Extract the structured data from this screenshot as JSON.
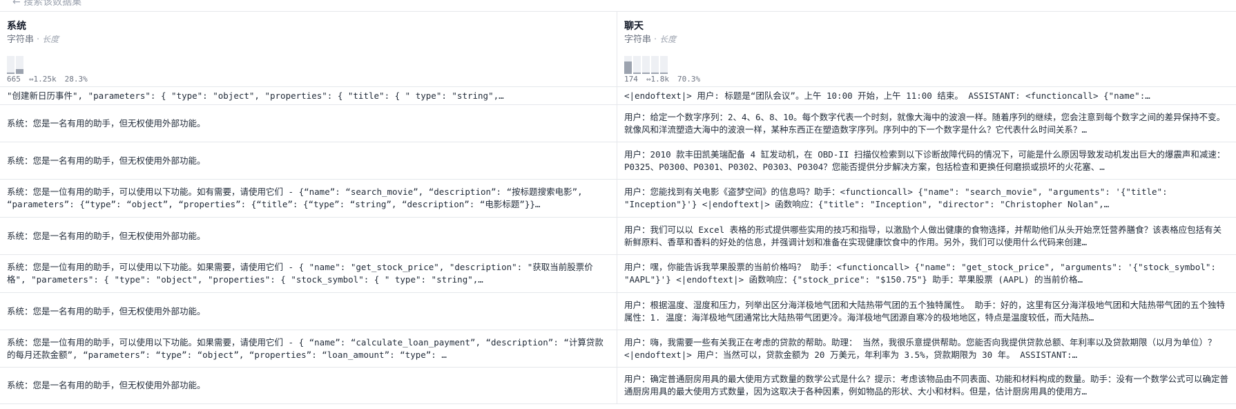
{
  "topbar": {
    "crumb": "← 搜索该数据集"
  },
  "columns": [
    {
      "title": "系统",
      "type_label": "字符串",
      "type_detail": "长度",
      "stats": [
        "665",
        "⇔1.25k",
        "28.3%"
      ],
      "hist": {
        "bins": [
          0.05,
          0.28
        ]
      }
    },
    {
      "title": "聊天",
      "type_label": "字符串",
      "type_detail": "长度",
      "stats": [
        "174",
        "⇔1.8k",
        "70.3%"
      ],
      "hist": {
        "bins": [
          0.7,
          0.08,
          0.08,
          0.05,
          0.04
        ]
      }
    }
  ],
  "rows": [
    {
      "system": "\"创建新日历事件\", \"parameters\": { \"type\": \"object\", \"properties\": { \"title\": { \" type\": \"string\",…",
      "chat": "<|endoftext|> 用户: 标题是“团队会议”。上午 10:00 开始，上午 11:00 结束。 ASSISTANT: <functioncall> {\"name\":…"
    },
    {
      "system": "系统：您是一名有用的助手，但无权使用外部功能。",
      "chat": "用户：给定一个数字序列：2、4、6、8、10。每个数字代表一个时刻，就像大海中的波浪一样。随着序列的继续，您会注意到每个数字之间的差异保持不变。就像风和洋流塑造大海中的波浪一样，某种东西正在塑造数字序列。序列中的下一个数字是什么？它代表什么时间关系？…"
    },
    {
      "system": "系统：您是一名有用的助手，但无权使用外部功能。",
      "chat": "用户：2010 款丰田凯美瑞配备 4 缸发动机，在 OBD-II 扫描仪检索到以下诊断故障代码的情况下，可能是什么原因导致发动机发出巨大的爆震声和减速：P0325、P0300、P0301、P0302、P0303、P0304？您能否提供分步解决方案，包括检查和更换任何磨损或损坏的火花塞、…"
    },
    {
      "system": "系统：您是一位有用的助手，可以使用以下功能。如有需要，请使用它们 - {“name”: “search_movie”, “description”: “按标题搜索电影”, “parameters”: {“type”: “object”, “properties”: {“title”: {“type”: “string”, “description”: “电影标题”}}…",
      "chat": "用户：您能找到有关电影《盗梦空间》的信息吗？助手：<functioncall> {\"name\": \"search_movie\", \"arguments\": '{\"title\": \"Inception\"}'} <|endoftext|> 函数响应：{\"title\": \"Inception\", \"director\": \"Christopher Nolan\",…"
    },
    {
      "system": "系统：您是一名有用的助手，但无权使用外部功能。",
      "chat": "用户：我们可以以 Excel 表格的形式提供哪些实用的技巧和指导，以激励个人做出健康的食物选择，并帮助他们从头开始烹饪营养膳食？该表格应包括有关新鲜原料、香草和香料的好处的信息，并强调计划和准备在实现健康饮食中的作用。另外，我们可以使用什么代码来创建…"
    },
    {
      "system": "系统：您是一位有用的助手，可以使用以下功能。如果需要，请使用它们 - { \"name\": \"get_stock_price\", \"description\": \"获取当前股票价格\", \"parameters\": { \"type\": \"object\", \"properties\": { \"stock_symbol\": { \" type\": \"string\",…",
      "chat": "用户：嘿，你能告诉我苹果股票的当前价格吗？ 助手：<functioncall> {\"name\": \"get_stock_price\", \"arguments\": '{\"stock_symbol\": \"AAPL\"}'} <|endoftext|> 函数响应：{\"stock_price\": \"$150.75\"} 助手：苹果股票 (AAPL) 的当前价格…"
    },
    {
      "system": "系统：您是一名有用的助手，但无权使用外部功能。",
      "chat": "用户：根据温度、湿度和压力，列举出区分海洋极地气团和大陆热带气团的五个独特属性。 助手：好的，这里有区分海洋极地气团和大陆热带气团的五个独特属性：1. 温度：海洋极地气团通常比大陆热带气团更冷。海洋极地气团源自寒冷的极地地区，特点是温度较低，而大陆热…"
    },
    {
      "system": "系统：您是一位有用的助手，可以使用以下功能。如果需要，请使用它们 - { “name”: “calculate_loan_payment”, “description”: “计算贷款的每月还款金额”, “parameters”: “type”: “object”, “properties”: “loan_amount”: “type”: …",
      "chat": "用户：嗨，我需要一些有关我正在考虑的贷款的帮助。助理： 当然，我很乐意提供帮助。您能否向我提供贷款总额、年利率以及贷款期限（以月为单位）？ <|endoftext|> 用户：当然可以，贷款金额为 20 万美元，年利率为 3.5%，贷款期限为 30 年。 ASSISTANT:…"
    },
    {
      "system": "系统：您是一名有用的助手，但无权使用外部功能。",
      "chat": "用户：确定普通厨房用具的最大使用方式数量的数学公式是什么？提示：考虑该物品由不同表面、功能和材料构成的数量。助手：没有一个数学公式可以确定普通厨房用具的最大使用方式数量，因为这取决于各种因素，例如物品的形状、大小和材料。但是，估计厨房用具的使用方…"
    }
  ]
}
